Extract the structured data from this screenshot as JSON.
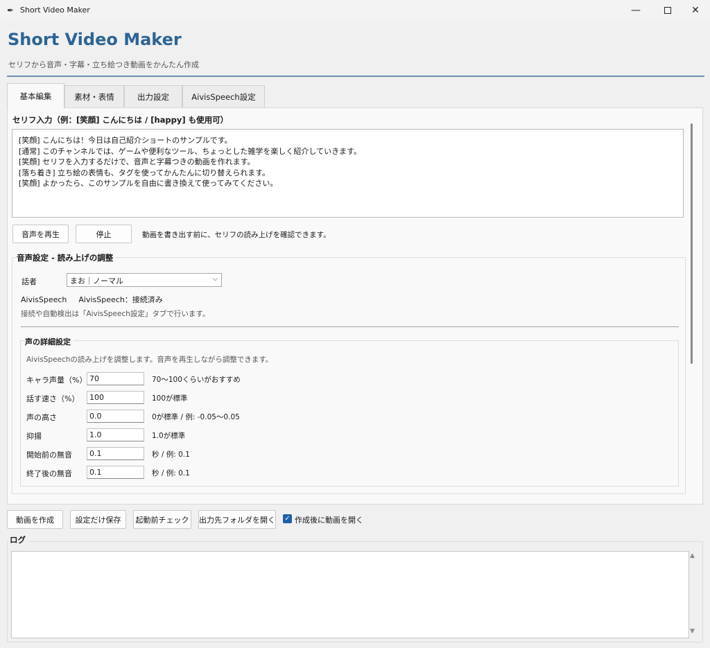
{
  "window": {
    "title": "Short Video Maker",
    "icon": "feather-icon"
  },
  "header": {
    "title": "Short Video Maker",
    "subtitle": "セリフから音声・字幕・立ち絵つき動画をかんたん作成"
  },
  "tabs": [
    {
      "label": "基本編集",
      "active": true
    },
    {
      "label": "素材・表情",
      "active": false
    },
    {
      "label": "出力設定",
      "active": false
    },
    {
      "label": "AivisSpeech設定",
      "active": false
    }
  ],
  "serif": {
    "label": "セリフ入力（例：[笑顔] こんにちは / [happy] も使用可）",
    "text": "[笑顔] こんにちは！今日は自己紹介ショートのサンプルです。\n[通常] このチャンネルでは、ゲームや便利なツール、ちょっとした雑学を楽しく紹介していきます。\n[笑顔] セリフを入力するだけで、音声と字幕つきの動画を作れます。\n[落ち着き] 立ち絵の表情も、タグを使ってかんたんに切り替えられます。\n[笑顔] よかったら、このサンプルを自由に書き換えて使ってみてください。"
  },
  "playback": {
    "play_label": "音声を再生",
    "stop_label": "停止",
    "hint": "動画を書き出す前に、セリフの読み上げを確認できます。"
  },
  "voice": {
    "section_title": "音声設定 - 読み上げの調整",
    "speaker_label": "話者",
    "speaker_value": "まお｜ノーマル",
    "status_engine": "AivisSpeech",
    "status_text": "AivisSpeech：接続済み",
    "note": "接続や自動検出は「AivisSpeech設定」タブで行います。"
  },
  "details": {
    "title": "声の詳細設定",
    "note": "AivisSpeechの読み上げを調整します。音声を再生しながら調整できます。",
    "rows": [
      {
        "label": "キャラ声量（%）",
        "value": "70",
        "hint": "70〜100くらいがおすすめ"
      },
      {
        "label": "話す速さ（%）",
        "value": "100",
        "hint": "100が標準"
      },
      {
        "label": "声の高さ",
        "value": "0.0",
        "hint": "0が標準 / 例: -0.05〜0.05"
      },
      {
        "label": "抑揚",
        "value": "1.0",
        "hint": "1.0が標準"
      },
      {
        "label": "開始前の無音",
        "value": "0.1",
        "hint": "秒 / 例: 0.1"
      },
      {
        "label": "終了後の無音",
        "value": "0.1",
        "hint": "秒 / 例: 0.1"
      }
    ]
  },
  "actions": {
    "create_label": "動画を作成",
    "save_label": "設定だけ保存",
    "check_label": "起動前チェック",
    "open_folder_label": "出力先フォルダを開く",
    "open_after_label": "作成後に動画を開く",
    "open_after_checked": true
  },
  "log": {
    "label": "ログ",
    "text": ""
  }
}
